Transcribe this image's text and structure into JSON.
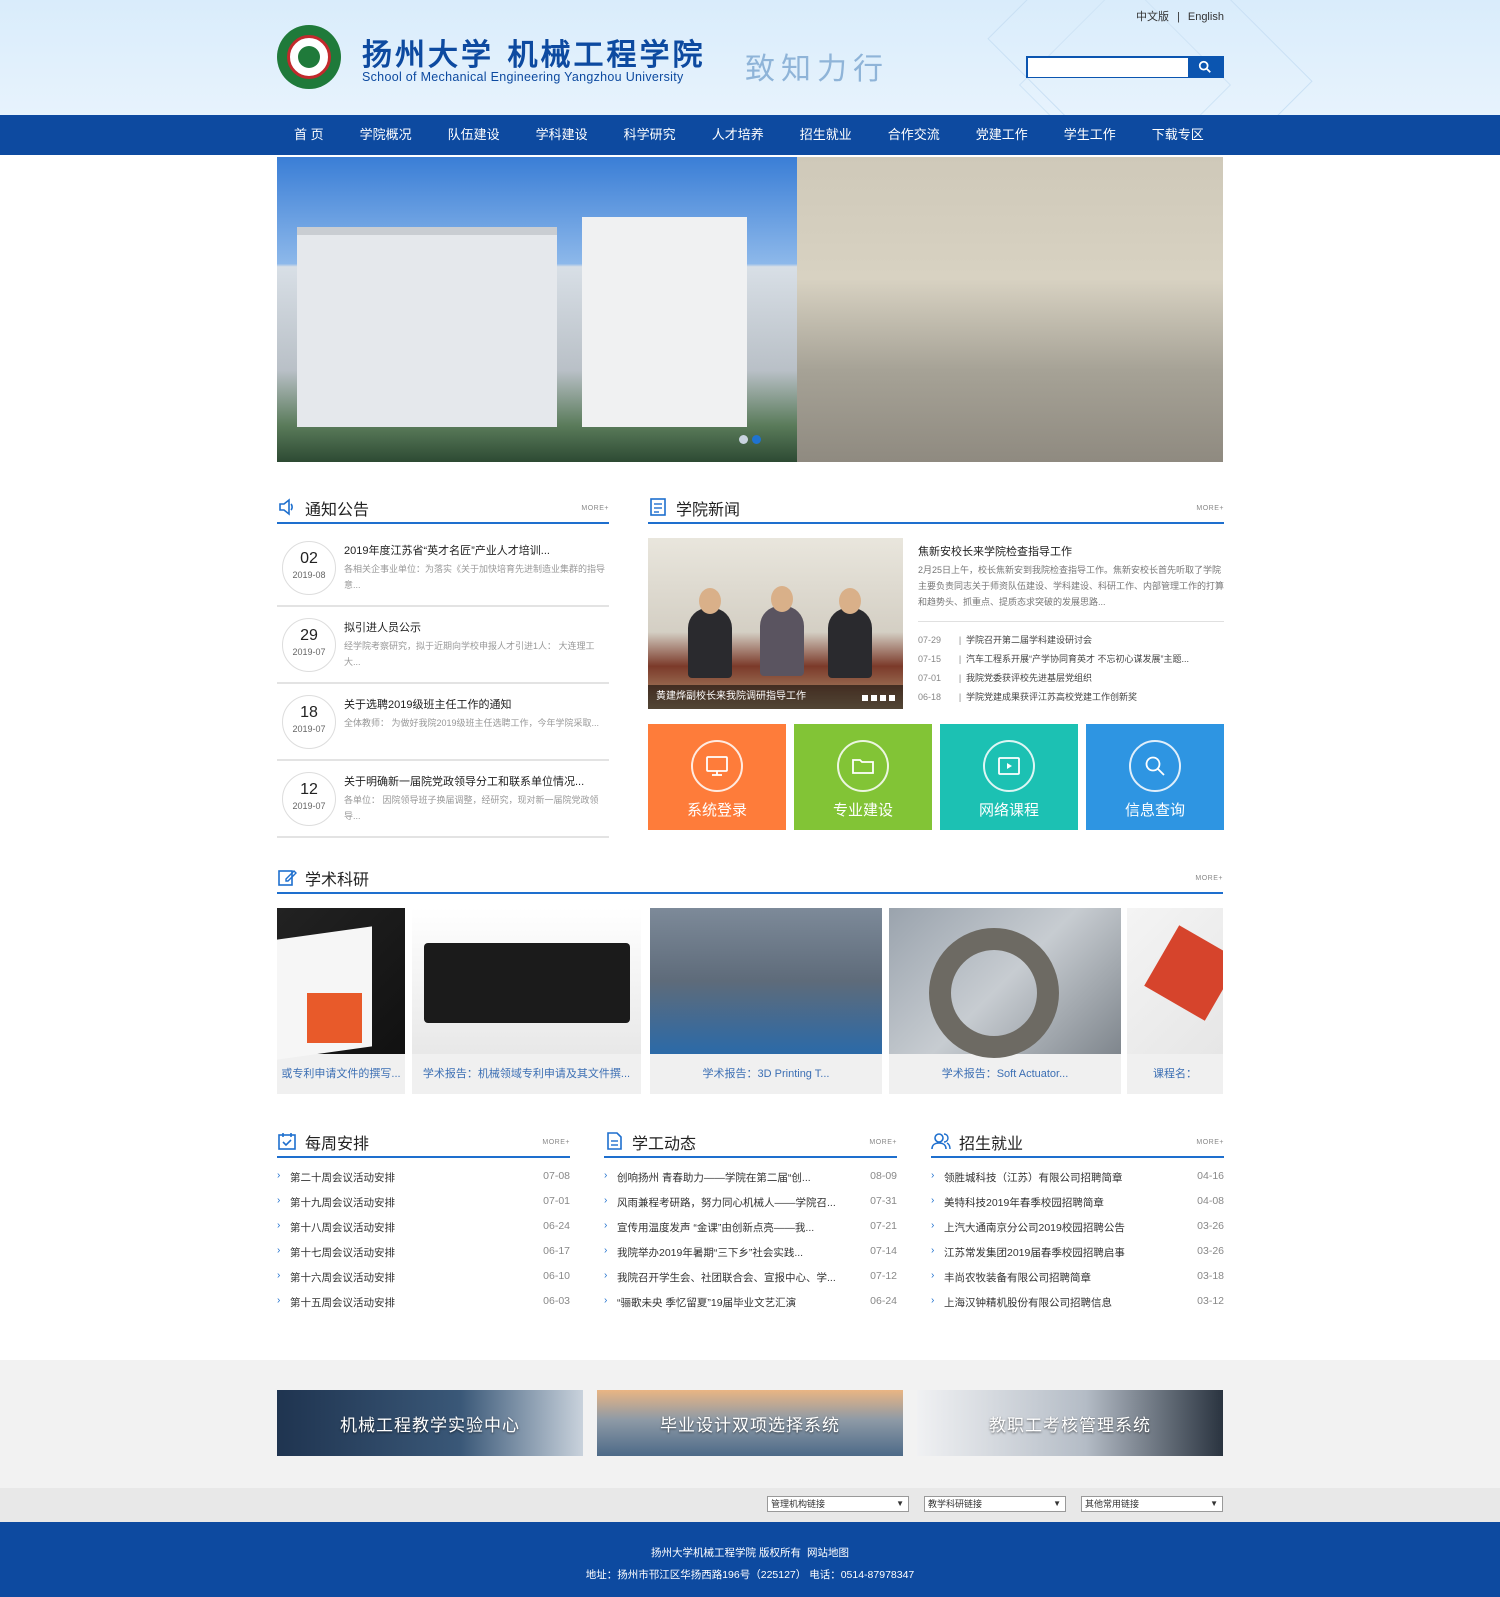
{
  "header": {
    "school_cn": "扬州大学 机械工程学院",
    "school_en": "School of Mechanical Engineering Yangzhou University",
    "motto": "致知力行",
    "lang_cn": "中文版",
    "lang_sep": "|",
    "lang_en": "English",
    "search_placeholder": ""
  },
  "nav": [
    "首 页",
    "学院概况",
    "队伍建设",
    "学科建设",
    "科学研究",
    "人才培养",
    "招生就业",
    "合作交流",
    "党建工作",
    "学生工作",
    "下载专区"
  ],
  "banner": {
    "slides": 2,
    "active": 2
  },
  "notices": {
    "title": "通知公告",
    "more": "MORE+",
    "items": [
      {
        "day": "02",
        "ym": "2019-08",
        "title": "2019年度江苏省“英才名匠”产业人才培训...",
        "summary": "各相关企事业单位：为落实《关于加快培育先进制造业集群的指导意..."
      },
      {
        "day": "29",
        "ym": "2019-07",
        "title": "拟引进人员公示",
        "summary": "经学院考察研究，拟于近期向学校申报人才引进1人： 大连理工大..."
      },
      {
        "day": "18",
        "ym": "2019-07",
        "title": "关于选聘2019级班主任工作的通知",
        "summary": "全体教师： 为做好我院2019级班主任选聘工作，今年学院采取..."
      },
      {
        "day": "12",
        "ym": "2019-07",
        "title": "关于明确新一届院党政领导分工和联系单位情况...",
        "summary": "各单位： 因院领导班子换届调整，经研究，现对新一届院党政领导..."
      }
    ]
  },
  "news": {
    "title": "学院新闻",
    "more": "MORE+",
    "photo_caption": "黄建烨副校长来我院调研指导工作",
    "headline": "焦新安校长来学院检查指导工作",
    "summary": "2月25日上午，校长焦新安到我院检查指导工作。焦新安校长首先听取了学院主要负责同志关于师资队伍建设、学科建设、科研工作、内部管理工作的打算和趋势头、抓重点、提质态求突破的发展思路...",
    "items": [
      {
        "date": "07-29",
        "sep": "|",
        "title": "学院召开第二届学科建设研讨会"
      },
      {
        "date": "07-15",
        "sep": "|",
        "title": "汽车工程系开展“产学协同育英才 不忘初心谋发展”主题..."
      },
      {
        "date": "07-01",
        "sep": "|",
        "title": "我院党委获评校先进基层党组织"
      },
      {
        "date": "06-18",
        "sep": "|",
        "title": "学院党建成果获评江苏高校党建工作创新奖"
      }
    ]
  },
  "tiles": [
    {
      "label": "系统登录",
      "icon": "monitor-icon",
      "color": "#fe7c3a"
    },
    {
      "label": "专业建设",
      "icon": "folder-icon",
      "color": "#82c436"
    },
    {
      "label": "网络课程",
      "icon": "video-icon",
      "color": "#1cc1b3"
    },
    {
      "label": "信息查询",
      "icon": "search-icon",
      "color": "#2e95e2"
    }
  ],
  "research": {
    "title": "学术科研",
    "more": "MORE+",
    "items": [
      "或专利申请文件的撰写...",
      "学术报告：机械领域专利申请及其文件撰...",
      "学术报告：3D Printing T...",
      "学术报告：Soft Actuator...",
      "课程名："
    ]
  },
  "weekly": {
    "title": "每周安排",
    "more": "MORE+",
    "items": [
      {
        "title": "第二十周会议活动安排",
        "date": "07-08"
      },
      {
        "title": "第十九周会议活动安排",
        "date": "07-01"
      },
      {
        "title": "第十八周会议活动安排",
        "date": "06-24"
      },
      {
        "title": "第十七周会议活动安排",
        "date": "06-17"
      },
      {
        "title": "第十六周会议活动安排",
        "date": "06-10"
      },
      {
        "title": "第十五周会议活动安排",
        "date": "06-03"
      }
    ]
  },
  "student": {
    "title": "学工动态",
    "more": "MORE+",
    "items": [
      {
        "title": "创响扬州 青春助力——学院在第二届“创...",
        "date": "08-09"
      },
      {
        "title": "风雨兼程考研路，努力同心机械人——学院召...",
        "date": "07-31"
      },
      {
        "title": "宣传用温度发声 “金课”由创新点亮——我...",
        "date": "07-21"
      },
      {
        "title": "我院举办2019年暑期“三下乡”社会实践...",
        "date": "07-14"
      },
      {
        "title": "我院召开学生会、社团联合会、宣报中心、学...",
        "date": "07-12"
      },
      {
        "title": "“骊歌未央 季忆留夏”19届毕业文艺汇演",
        "date": "06-24"
      }
    ]
  },
  "jobs": {
    "title": "招生就业",
    "more": "MORE+",
    "items": [
      {
        "title": "领胜城科技（江苏）有限公司招聘简章",
        "date": "04-16"
      },
      {
        "title": "美特科技2019年春季校园招聘简章",
        "date": "04-08"
      },
      {
        "title": "上汽大通南京分公司2019校园招聘公告",
        "date": "03-26"
      },
      {
        "title": "江苏常发集团2019届春季校园招聘启事",
        "date": "03-26"
      },
      {
        "title": "丰尚农牧装备有限公司招聘简章",
        "date": "03-18"
      },
      {
        "title": "上海汉钟精机股份有限公司招聘信息",
        "date": "03-12"
      }
    ]
  },
  "systems": [
    "机械工程教学实验中心",
    "毕业设计双项选择系统",
    "教职工考核管理系统"
  ],
  "links": [
    "管理机构链接",
    "教学科研链接",
    "其他常用链接"
  ],
  "footer": {
    "copyright": "扬州大学机械工程学院 版权所有",
    "sitemap": "网站地图",
    "address": "地址：扬州市邗江区华扬西路196号（225127） 电话：0514-87978347"
  },
  "colors": {
    "primary": "#0d4aa0",
    "accent": "#1e6fce",
    "header_bg": "#dcedfb"
  }
}
